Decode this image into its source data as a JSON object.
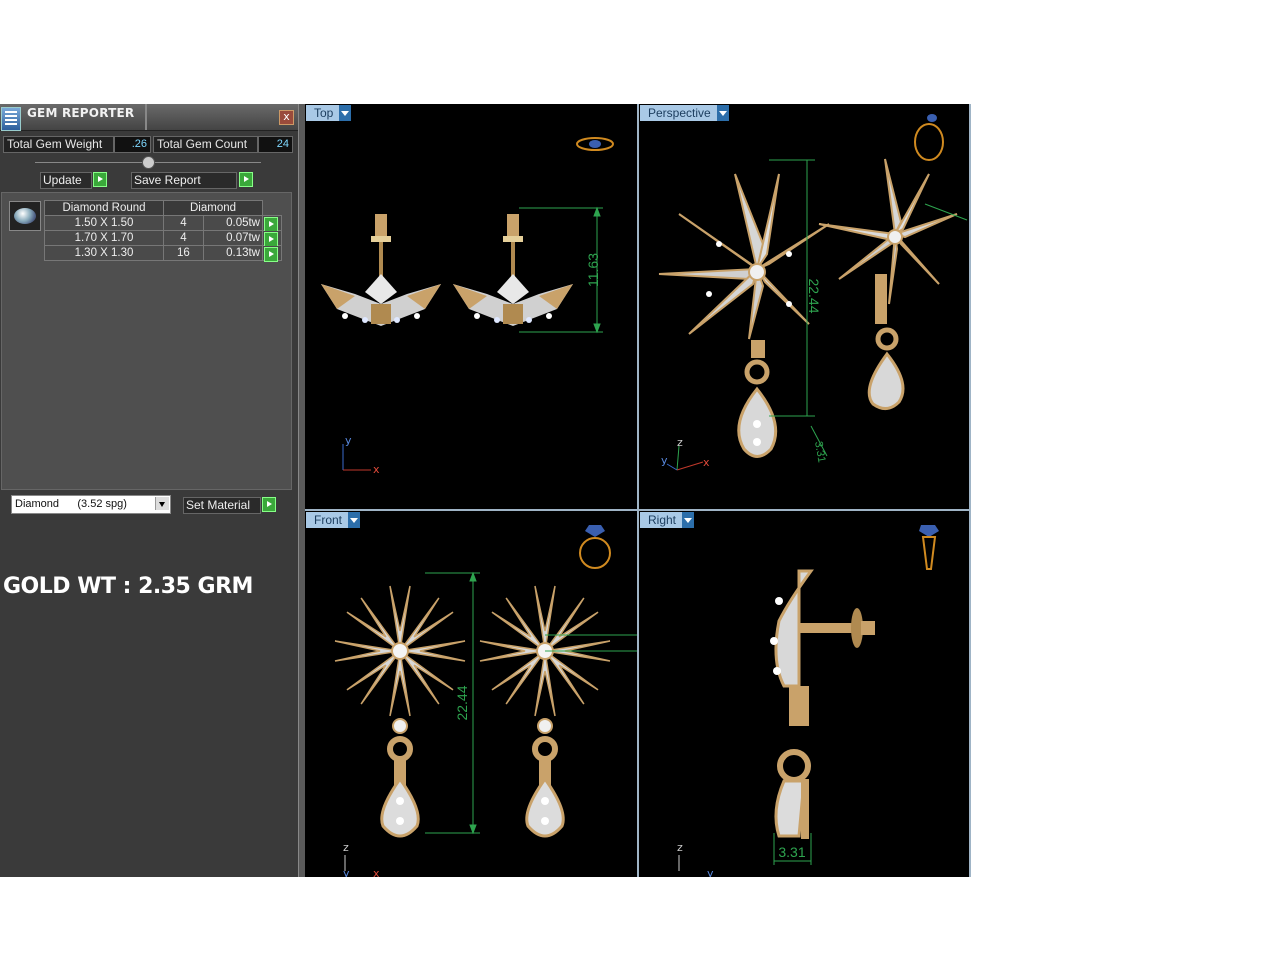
{
  "panel": {
    "title": "GEM REPORTER",
    "close_label": "x",
    "total_weight_label": "Total Gem Weight",
    "total_weight_value": ".26",
    "total_count_label": "Total Gem Count",
    "total_count_value": "24",
    "update_label": "Update",
    "save_report_label": "Save Report",
    "table": {
      "headers": [
        "Diamond Round",
        "Diamond"
      ],
      "rows": [
        {
          "size": "1.50 X 1.50",
          "count": "4",
          "weight": "0.05tw"
        },
        {
          "size": "1.70 X 1.70",
          "count": "4",
          "weight": "0.07tw"
        },
        {
          "size": "1.30 X 1.30",
          "count": "16",
          "weight": "0.13tw"
        }
      ]
    },
    "material_value": "Diamond      (3.52 spg)",
    "set_material_label": "Set Material"
  },
  "annotation": {
    "gold_weight": "GOLD WT : 2.35 GRM"
  },
  "viewports": {
    "top": {
      "label": "Top",
      "dimension": "11.63",
      "axes": [
        "y",
        "x"
      ]
    },
    "perspective": {
      "label": "Perspective",
      "dimension": "22.44",
      "dimension2": "3.31",
      "axes": [
        "z",
        "y",
        "x"
      ]
    },
    "front": {
      "label": "Front",
      "dimension": "22.44",
      "axes": [
        "z",
        "y",
        "x"
      ]
    },
    "right": {
      "label": "Right",
      "dimension": "3.31",
      "axes": [
        "z",
        "y"
      ]
    }
  },
  "colors": {
    "dimension": "#2ea44f",
    "metal_gold": "#c9a26a",
    "metal_white": "#e6e6e6",
    "tab_bg": "#a9c9e6"
  }
}
